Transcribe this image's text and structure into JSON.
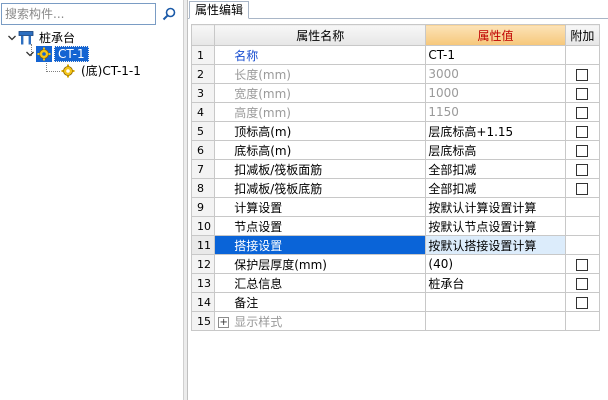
{
  "search": {
    "placeholder": "搜索构件..."
  },
  "tree": {
    "root": {
      "label": "桩承台"
    },
    "child": {
      "label": "CT-1"
    },
    "grandchild": {
      "label": "(底)CT-1-1"
    }
  },
  "tabs": [
    {
      "label": "属性编辑"
    }
  ],
  "grid": {
    "headers": {
      "name": "属性名称",
      "value": "属性值",
      "extra": "附加"
    },
    "rows": [
      {
        "num": "1",
        "name": "名称",
        "value": "CT-1",
        "has_check": false
      },
      {
        "num": "2",
        "name": "长度(mm)",
        "value": "3000",
        "has_check": true
      },
      {
        "num": "3",
        "name": "宽度(mm)",
        "value": "1000",
        "has_check": true
      },
      {
        "num": "4",
        "name": "高度(mm)",
        "value": "1150",
        "has_check": true
      },
      {
        "num": "5",
        "name": "顶标高(m)",
        "value": "层底标高+1.15",
        "has_check": true
      },
      {
        "num": "6",
        "name": "底标高(m)",
        "value": "层底标高",
        "has_check": true
      },
      {
        "num": "7",
        "name": "扣减板/筏板面筋",
        "value": "全部扣减",
        "has_check": true
      },
      {
        "num": "8",
        "name": "扣减板/筏板底筋",
        "value": "全部扣减",
        "has_check": true
      },
      {
        "num": "9",
        "name": "计算设置",
        "value": "按默认计算设置计算",
        "has_check": false
      },
      {
        "num": "10",
        "name": "节点设置",
        "value": "按默认节点设置计算",
        "has_check": false
      },
      {
        "num": "11",
        "name": "搭接设置",
        "value": "按默认搭接设置计算",
        "has_check": false
      },
      {
        "num": "12",
        "name": "保护层厚度(mm)",
        "value": "(40)",
        "has_check": true
      },
      {
        "num": "13",
        "name": "汇总信息",
        "value": "桩承台",
        "has_check": true
      },
      {
        "num": "14",
        "name": "备注",
        "value": "",
        "has_check": true
      },
      {
        "num": "15",
        "name": "显示样式",
        "value": "",
        "has_check": false,
        "expand_symbol": "+"
      }
    ]
  },
  "colors": {
    "selection": "#0a64d8",
    "header_value_text": "#c00000",
    "name_blue": "#1a4fd0"
  }
}
